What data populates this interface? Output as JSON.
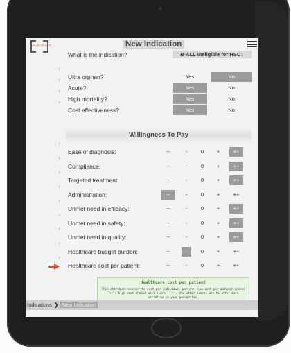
{
  "app": {
    "logo_text": "VALUE INSIGHT",
    "title": "New Indication"
  },
  "indication": {
    "question": "What is the indication?",
    "value": "B-ALL ineligible for HSCT"
  },
  "binary_questions": [
    {
      "label": "Ultra orphan?",
      "yes": "Yes",
      "no": "No",
      "selected": "No"
    },
    {
      "label": "Acute?",
      "yes": "Yes",
      "no": "No",
      "selected": "Yes"
    },
    {
      "label": "High mortality?",
      "yes": "Yes",
      "no": "No",
      "selected": "Yes"
    },
    {
      "label": "Cost effectiveness?",
      "yes": "Yes",
      "no": "No",
      "selected": "Yes"
    }
  ],
  "wtp": {
    "title": "Willingness To Pay",
    "scale": [
      "--",
      "-",
      "0",
      "+",
      "++"
    ],
    "rows": [
      {
        "label": "Ease of diagnosis:",
        "selected": 4
      },
      {
        "label": "Compliance:",
        "selected": 4
      },
      {
        "label": "Targeted treatment:",
        "selected": 4
      },
      {
        "label": "Administration:",
        "selected": 0
      },
      {
        "label": "Unmet need in efficacy:",
        "selected": 4
      },
      {
        "label": "Unmet need in safety:",
        "selected": 4
      },
      {
        "label": "Unmet need in quality:",
        "selected": 4
      },
      {
        "label": "Healthcare budget burden:",
        "selected": 1
      },
      {
        "label": "Healthcare cost per patient:",
        "selected": -1
      }
    ]
  },
  "tooltip": {
    "title": "Healthcare cost per patient",
    "body": "This attribute scores the cost per individual patient. Low cost per patient scores \"++\"; high cost should will score \"--\" ; the other scores are to offer more variation in your perception."
  },
  "breadcrumb": {
    "home": "Indications",
    "separator": "❯",
    "current": "New Indication"
  },
  "colors": {
    "selected": "#9b9b9b",
    "arrow": "#c9553e",
    "tooltip_bg": "#e8f4e1"
  }
}
